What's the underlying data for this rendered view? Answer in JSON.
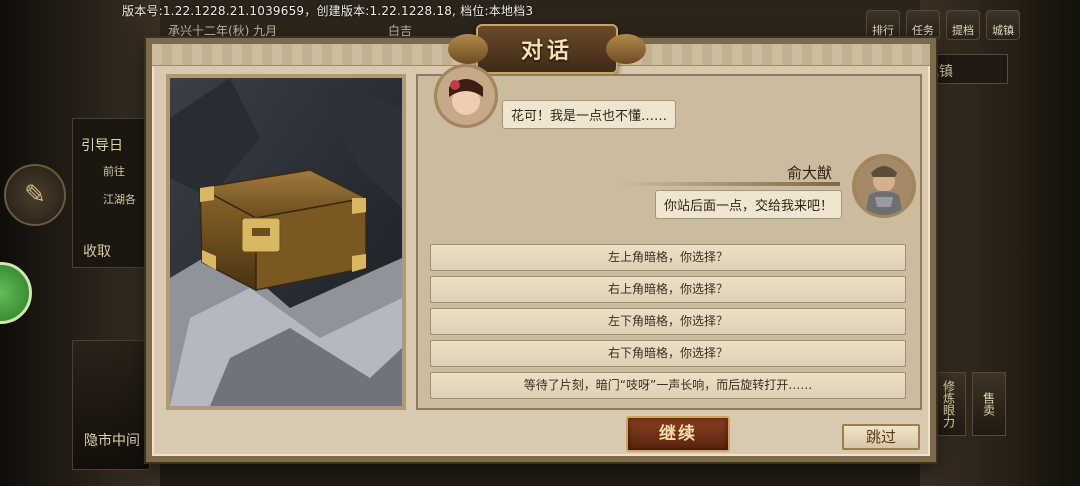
{
  "top_bar": {
    "version_text": "版本号:1.22.1228.21.1039659，创建版本:1.22.1228.18, 档位:本地档3",
    "date_text": "承兴十二年(秋) 九月",
    "weather_text": "白吉",
    "icons": [
      {
        "name": "rank-icon",
        "label": "排行"
      },
      {
        "name": "quest-icon",
        "label": "任务"
      },
      {
        "name": "upgrade-icon",
        "label": "提档"
      },
      {
        "name": "town-icon",
        "label": "城镇"
      }
    ],
    "town_label": "城镇"
  },
  "left_hud": {
    "panel_title": "引导日",
    "item_1": "前往",
    "item_2": "江湖各",
    "item_3": "收取",
    "bottom_label": "隐市中间"
  },
  "right_hud": {
    "buttons": [
      "修炼眼力",
      "售卖"
    ]
  },
  "dialog": {
    "title": "对话",
    "messages": [
      {
        "speaker": "",
        "text": "花可！我是一点也不懂……"
      },
      {
        "speaker": "俞大猷",
        "text": "你站后面一点，交给我来吧！"
      }
    ],
    "choices": [
      "左上角暗格，你选择？",
      "右上角暗格，你选择？",
      "左下角暗格，你选择？",
      "右下角暗格，你选择？",
      "等待了片刻，暗门“吱呀”一声长响，而后旋转打开……"
    ],
    "continue_label": "继续",
    "skip_label": "跳过"
  },
  "colors": {
    "dialog_bg": "#d8cab0",
    "choice_bg": "#ece1c9",
    "continue_bg": "#8a3e1f",
    "title_text": "#f6e2b0"
  }
}
